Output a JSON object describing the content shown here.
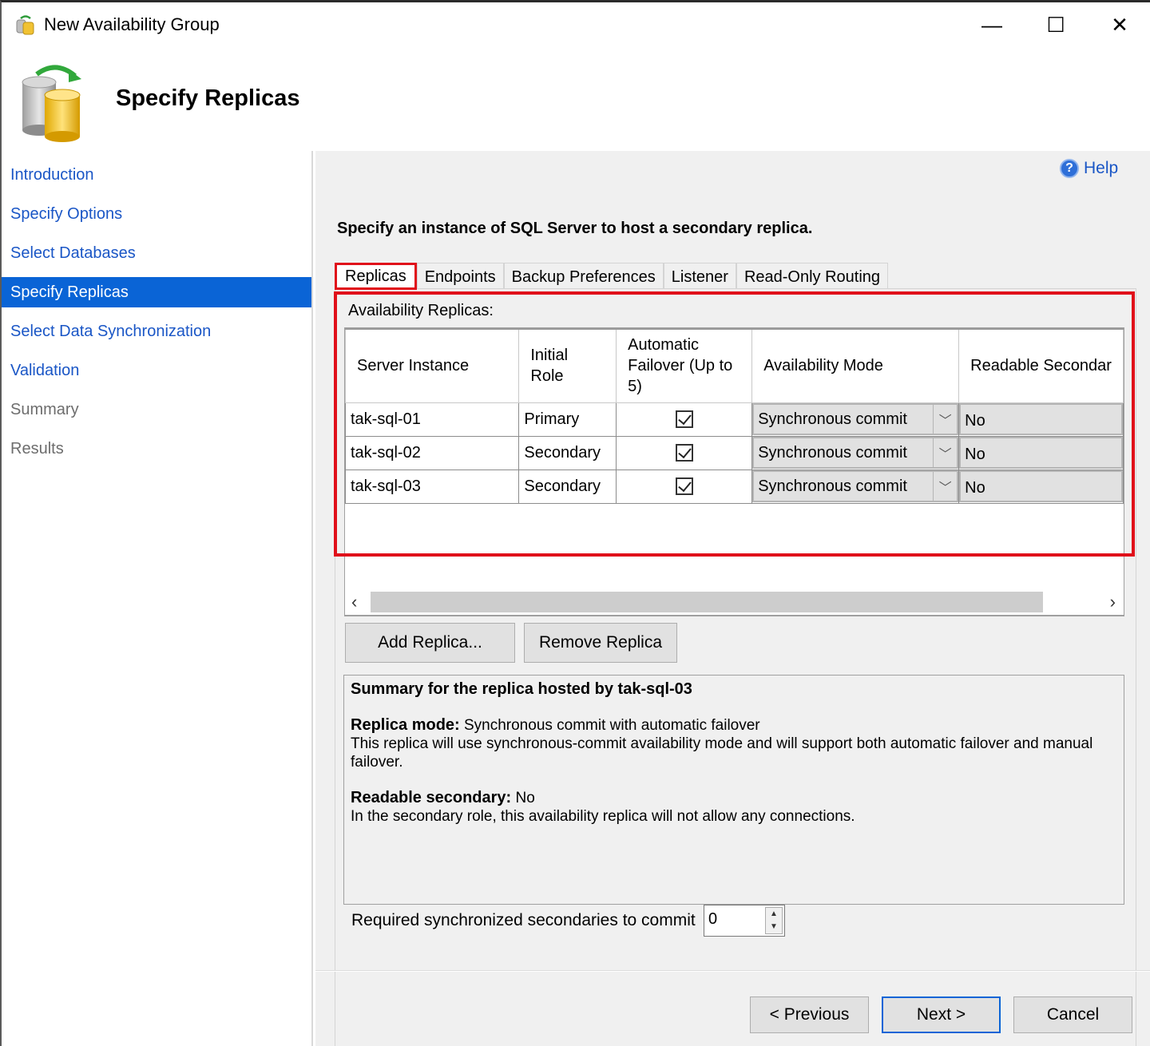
{
  "window": {
    "title": "New Availability Group",
    "minimize_glyph": "—",
    "maximize_glyph": "☐",
    "close_glyph": "✕"
  },
  "header": {
    "page_title": "Specify Replicas"
  },
  "sidebar": {
    "items": [
      {
        "label": "Introduction",
        "state": "link"
      },
      {
        "label": "Specify Options",
        "state": "link"
      },
      {
        "label": "Select Databases",
        "state": "link"
      },
      {
        "label": "Specify Replicas",
        "state": "active"
      },
      {
        "label": "Select Data Synchronization",
        "state": "link"
      },
      {
        "label": "Validation",
        "state": "link"
      },
      {
        "label": "Summary",
        "state": "disabled"
      },
      {
        "label": "Results",
        "state": "disabled"
      }
    ]
  },
  "main": {
    "help_label": "Help",
    "instruction": "Specify an instance of SQL Server to host a secondary replica.",
    "tabs": [
      {
        "label": "Replicas",
        "active": true
      },
      {
        "label": "Endpoints"
      },
      {
        "label": "Backup Preferences"
      },
      {
        "label": "Listener"
      },
      {
        "label": "Read-Only Routing"
      }
    ],
    "section_label": "Availability Replicas:",
    "columns": {
      "server_instance": "Server Instance",
      "initial_role": "Initial Role",
      "automatic_failover": "Automatic Failover (Up to 5)",
      "availability_mode": "Availability Mode",
      "readable_secondary": "Readable Secondar"
    },
    "rows": [
      {
        "server": "tak-sql-01",
        "role": "Primary",
        "failover": true,
        "mode": "Synchronous commit",
        "readable": "No"
      },
      {
        "server": "tak-sql-02",
        "role": "Secondary",
        "failover": true,
        "mode": "Synchronous commit",
        "readable": "No"
      },
      {
        "server": "tak-sql-03",
        "role": "Secondary",
        "failover": true,
        "mode": "Synchronous commit",
        "readable": "No"
      }
    ],
    "add_replica_label": "Add Replica...",
    "remove_replica_label": "Remove Replica",
    "summary": {
      "title": "Summary for the replica hosted by tak-sql-03",
      "replica_mode_label": "Replica mode:",
      "replica_mode_value": "Synchronous commit with automatic failover",
      "replica_mode_desc": "This replica will use synchronous-commit availability mode and will support both automatic failover and manual failover.",
      "readable_label": "Readable secondary:",
      "readable_value": "No",
      "readable_desc": "In the secondary role, this availability replica will not allow any connections."
    },
    "required_sync_label": "Required synchronized secondaries to commit",
    "required_sync_value": "0"
  },
  "footer": {
    "previous_label": "< Previous",
    "next_label": "Next >",
    "cancel_label": "Cancel"
  },
  "colors": {
    "accent": "#0a64d6",
    "highlight_box": "#e0101a",
    "link": "#1a56c6"
  }
}
